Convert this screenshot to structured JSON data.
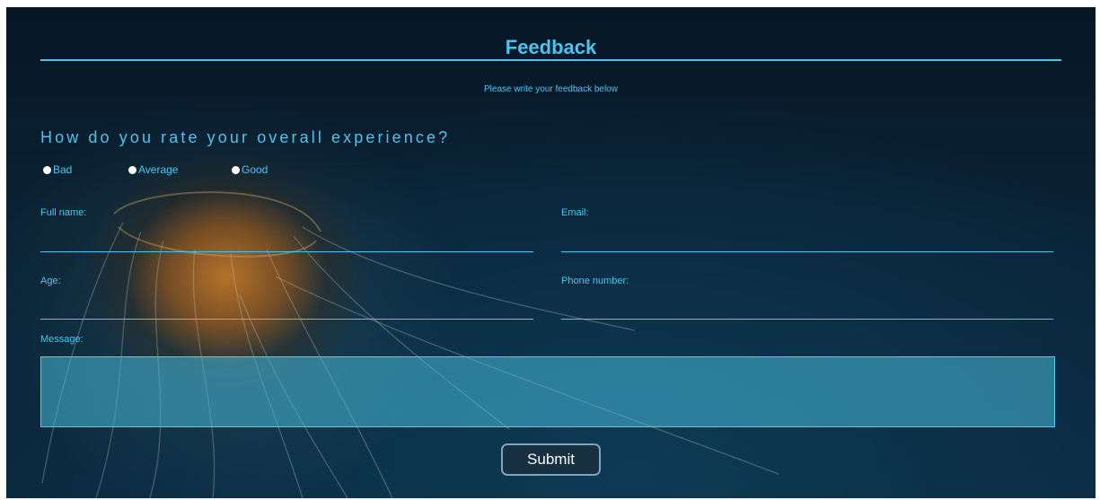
{
  "header": {
    "title": "Feedback",
    "subtitle": "Please write your feedback below"
  },
  "rating": {
    "question": "How do you rate your overall experience?",
    "options": [
      "Bad",
      "Average",
      "Good"
    ]
  },
  "form": {
    "full_name_label": "Full name:",
    "email_label": "Email:",
    "age_label": "Age:",
    "phone_label": "Phone number:",
    "message_label": "Message:"
  },
  "actions": {
    "submit_label": "Submit"
  },
  "colors": {
    "accent": "#4ec3ee",
    "background": "#0a2336",
    "message_fill": "#47b9da",
    "button_bg": "#163041"
  }
}
